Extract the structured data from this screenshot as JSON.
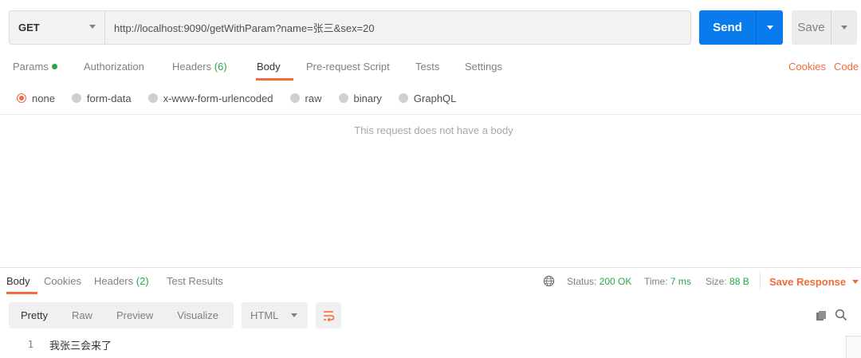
{
  "request": {
    "method": "GET",
    "url": "http://localhost:9090/getWithParam?name=张三&sex=20",
    "send_label": "Send",
    "save_label": "Save"
  },
  "request_tabs": {
    "params": "Params",
    "authorization": "Authorization",
    "headers": "Headers",
    "headers_count": "(6)",
    "body": "Body",
    "prerequest": "Pre-request Script",
    "tests": "Tests",
    "settings": "Settings",
    "cookies": "Cookies",
    "code": "Code"
  },
  "body_types": {
    "none": "none",
    "form_data": "form-data",
    "urlencoded": "x-www-form-urlencoded",
    "raw": "raw",
    "binary": "binary",
    "graphql": "GraphQL",
    "selected": "none"
  },
  "empty_body_message": "This request does not have a body",
  "response_tabs": {
    "body": "Body",
    "cookies": "Cookies",
    "headers": "Headers",
    "headers_count": "(2)",
    "test_results": "Test Results"
  },
  "response_status": {
    "status_label": "Status:",
    "status_value": "200 OK",
    "time_label": "Time:",
    "time_value": "7 ms",
    "size_label": "Size:",
    "size_value": "88 B",
    "save_response": "Save Response"
  },
  "response_view": {
    "formats": [
      "Pretty",
      "Raw",
      "Preview",
      "Visualize"
    ],
    "active_format": "Pretty",
    "language": "HTML"
  },
  "response_body": {
    "lines": [
      {
        "num": "1",
        "text": "我张三会来了"
      }
    ]
  },
  "colors": {
    "accent": "#f26b3a",
    "send_blue": "#097bed",
    "success_green": "#28a745"
  },
  "icons": {
    "globe": "globe-icon",
    "copy": "copy-icon",
    "search": "search-icon",
    "wrap": "wrap-lines-icon"
  }
}
